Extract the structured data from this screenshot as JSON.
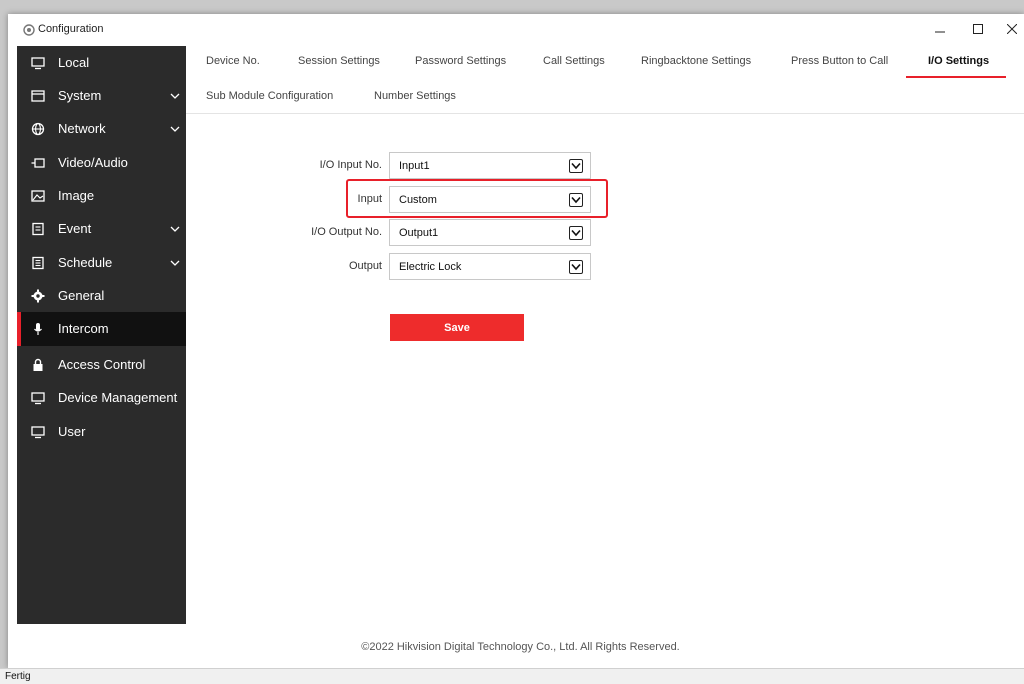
{
  "window": {
    "title": "Configuration",
    "minimize_icon": "minimize-icon",
    "maximize_icon": "maximize-icon",
    "close_icon": "close-icon"
  },
  "sidebar": {
    "items": [
      {
        "label": "Local",
        "icon": "monitor-icon",
        "expandable": false,
        "active": false
      },
      {
        "label": "System",
        "icon": "window-icon",
        "expandable": true,
        "active": false
      },
      {
        "label": "Network",
        "icon": "globe-icon",
        "expandable": true,
        "active": false
      },
      {
        "label": "Video/Audio",
        "icon": "camera-icon",
        "expandable": false,
        "active": false
      },
      {
        "label": "Image",
        "icon": "image-icon",
        "expandable": false,
        "active": false
      },
      {
        "label": "Event",
        "icon": "event-icon",
        "expandable": true,
        "active": false
      },
      {
        "label": "Schedule",
        "icon": "calendar-icon",
        "expandable": true,
        "active": false
      },
      {
        "label": "General",
        "icon": "gear-icon",
        "expandable": false,
        "active": false
      },
      {
        "label": "Intercom",
        "icon": "microphone-icon",
        "expandable": false,
        "active": true
      },
      {
        "label": "Access Control",
        "icon": "lock-icon",
        "expandable": false,
        "active": false
      },
      {
        "label": "Device Management",
        "icon": "monitor-icon",
        "expandable": false,
        "active": false
      },
      {
        "label": "User",
        "icon": "monitor-icon",
        "expandable": false,
        "active": false
      }
    ]
  },
  "tabs": {
    "row1": [
      "Device No.",
      "Session Settings",
      "Password Settings",
      "Call Settings",
      "Ringbacktone Settings",
      "Press Button to Call",
      "I/O Settings"
    ],
    "row2": [
      "Sub Module Configuration",
      "Number Settings"
    ],
    "active": "I/O Settings"
  },
  "form": {
    "io_input_no": {
      "label": "I/O Input No.",
      "value": "Input1"
    },
    "input": {
      "label": "Input",
      "value": "Custom"
    },
    "io_output_no": {
      "label": "I/O Output No.",
      "value": "Output1"
    },
    "output": {
      "label": "Output",
      "value": "Electric Lock"
    },
    "save_label": "Save"
  },
  "footer": {
    "copyright": "©2022 Hikvision Digital Technology Co., Ltd. All Rights Reserved."
  },
  "statusbar": {
    "text": "Fertig"
  },
  "colors": {
    "accent": "#e8202a",
    "sidebar_bg": "#2b2b2b",
    "sidebar_active_bg": "#111111"
  }
}
